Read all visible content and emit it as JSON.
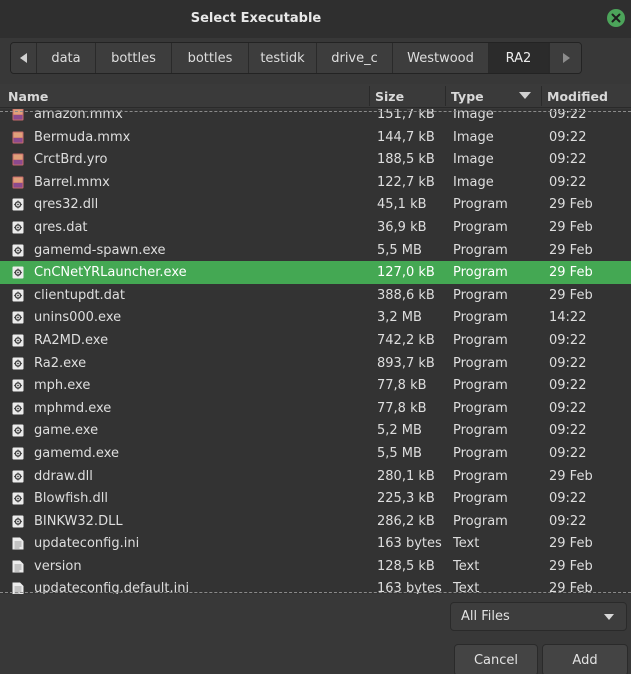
{
  "window": {
    "title": "Select Executable"
  },
  "pathbar": {
    "crumbs": [
      "data",
      "bottles",
      "bottles",
      "testidk",
      "drive_c",
      "Westwood",
      "RA2"
    ]
  },
  "columns": {
    "name": "Name",
    "size": "Size",
    "type": "Type",
    "modified": "Modified"
  },
  "files": [
    {
      "name": "amazon.mmx",
      "size": "151,7 kB",
      "type": "Image",
      "modified": "09:22",
      "icon": "image-file-icon"
    },
    {
      "name": "Bermuda.mmx",
      "size": "144,7 kB",
      "type": "Image",
      "modified": "09:22",
      "icon": "image-file-icon"
    },
    {
      "name": "CrctBrd.yro",
      "size": "188,5 kB",
      "type": "Image",
      "modified": "09:22",
      "icon": "image-file-icon"
    },
    {
      "name": "Barrel.mmx",
      "size": "122,7 kB",
      "type": "Image",
      "modified": "09:22",
      "icon": "image-file-icon"
    },
    {
      "name": "qres32.dll",
      "size": "45,1 kB",
      "type": "Program",
      "modified": "29 Feb",
      "icon": "program-file-icon"
    },
    {
      "name": "qres.dat",
      "size": "36,9 kB",
      "type": "Program",
      "modified": "29 Feb",
      "icon": "program-file-icon"
    },
    {
      "name": "gamemd-spawn.exe",
      "size": "5,5 MB",
      "type": "Program",
      "modified": "29 Feb",
      "icon": "program-file-icon"
    },
    {
      "name": "CnCNetYRLauncher.exe",
      "size": "127,0 kB",
      "type": "Program",
      "modified": "29 Feb",
      "icon": "program-file-icon",
      "selected": true
    },
    {
      "name": "clientupdt.dat",
      "size": "388,6 kB",
      "type": "Program",
      "modified": "29 Feb",
      "icon": "program-file-icon"
    },
    {
      "name": "unins000.exe",
      "size": "3,2 MB",
      "type": "Program",
      "modified": "14:22",
      "icon": "program-file-icon"
    },
    {
      "name": "RA2MD.exe",
      "size": "742,2 kB",
      "type": "Program",
      "modified": "09:22",
      "icon": "program-file-icon"
    },
    {
      "name": "Ra2.exe",
      "size": "893,7 kB",
      "type": "Program",
      "modified": "09:22",
      "icon": "program-file-icon"
    },
    {
      "name": "mph.exe",
      "size": "77,8 kB",
      "type": "Program",
      "modified": "09:22",
      "icon": "program-file-icon"
    },
    {
      "name": "mphmd.exe",
      "size": "77,8 kB",
      "type": "Program",
      "modified": "09:22",
      "icon": "program-file-icon"
    },
    {
      "name": "game.exe",
      "size": "5,2 MB",
      "type": "Program",
      "modified": "09:22",
      "icon": "program-file-icon"
    },
    {
      "name": "gamemd.exe",
      "size": "5,5 MB",
      "type": "Program",
      "modified": "09:22",
      "icon": "program-file-icon"
    },
    {
      "name": "ddraw.dll",
      "size": "280,1 kB",
      "type": "Program",
      "modified": "29 Feb",
      "icon": "program-file-icon"
    },
    {
      "name": "Blowfish.dll",
      "size": "225,3 kB",
      "type": "Program",
      "modified": "09:22",
      "icon": "program-file-icon"
    },
    {
      "name": "BINKW32.DLL",
      "size": "286,2 kB",
      "type": "Program",
      "modified": "09:22",
      "icon": "program-file-icon"
    },
    {
      "name": "updateconfig.ini",
      "size": "163 bytes",
      "type": "Text",
      "modified": "29 Feb",
      "icon": "text-file-icon"
    },
    {
      "name": "version",
      "size": "128,5 kB",
      "type": "Text",
      "modified": "29 Feb",
      "icon": "text-file-icon"
    },
    {
      "name": "updateconfig.default.ini",
      "size": "163 bytes",
      "type": "Text",
      "modified": "29 Feb",
      "icon": "text-file-icon"
    }
  ],
  "filter": {
    "selected": "All Files"
  },
  "buttons": {
    "cancel": "Cancel",
    "add": "Add"
  },
  "colors": {
    "selection": "#44a853",
    "close": "#4ca45a",
    "background": "#383838"
  }
}
